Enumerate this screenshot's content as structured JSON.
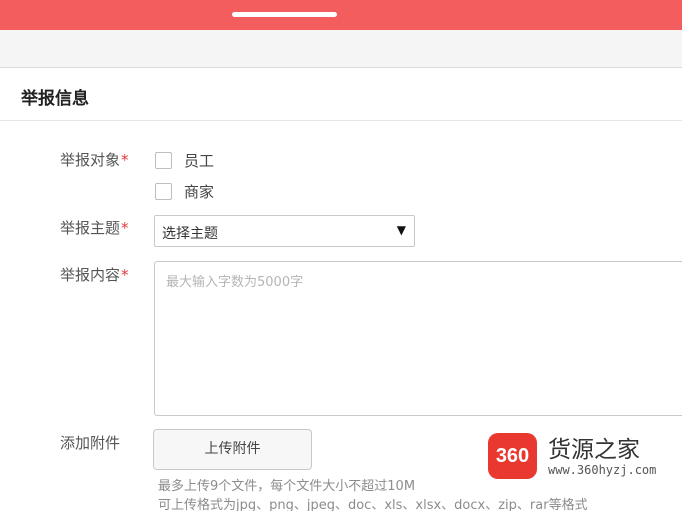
{
  "form": {
    "section_title": "举报信息",
    "required_mark": "*",
    "target": {
      "label": "举报对象",
      "options": [
        "员工",
        "商家"
      ]
    },
    "topic": {
      "label": "举报主题",
      "selected": "选择主题",
      "arrow": "▼"
    },
    "content": {
      "label": "举报内容",
      "placeholder": "最大输入字数为5000字"
    },
    "attachment": {
      "label": "添加附件",
      "button": "上传附件",
      "note_line1": "最多上传9个文件，每个文件大小不超过10M",
      "note_line2": "可上传格式为jpg、png、jpeg、doc、xls、xlsx、docx、zip、rar等格式"
    }
  },
  "watermark": {
    "badge": "360",
    "name": "货源之家",
    "url": "www.360hyzj.com"
  },
  "colors": {
    "topbar": "#f45d5e",
    "required": "#e4393c",
    "watermark_badge": "#e8382f"
  }
}
